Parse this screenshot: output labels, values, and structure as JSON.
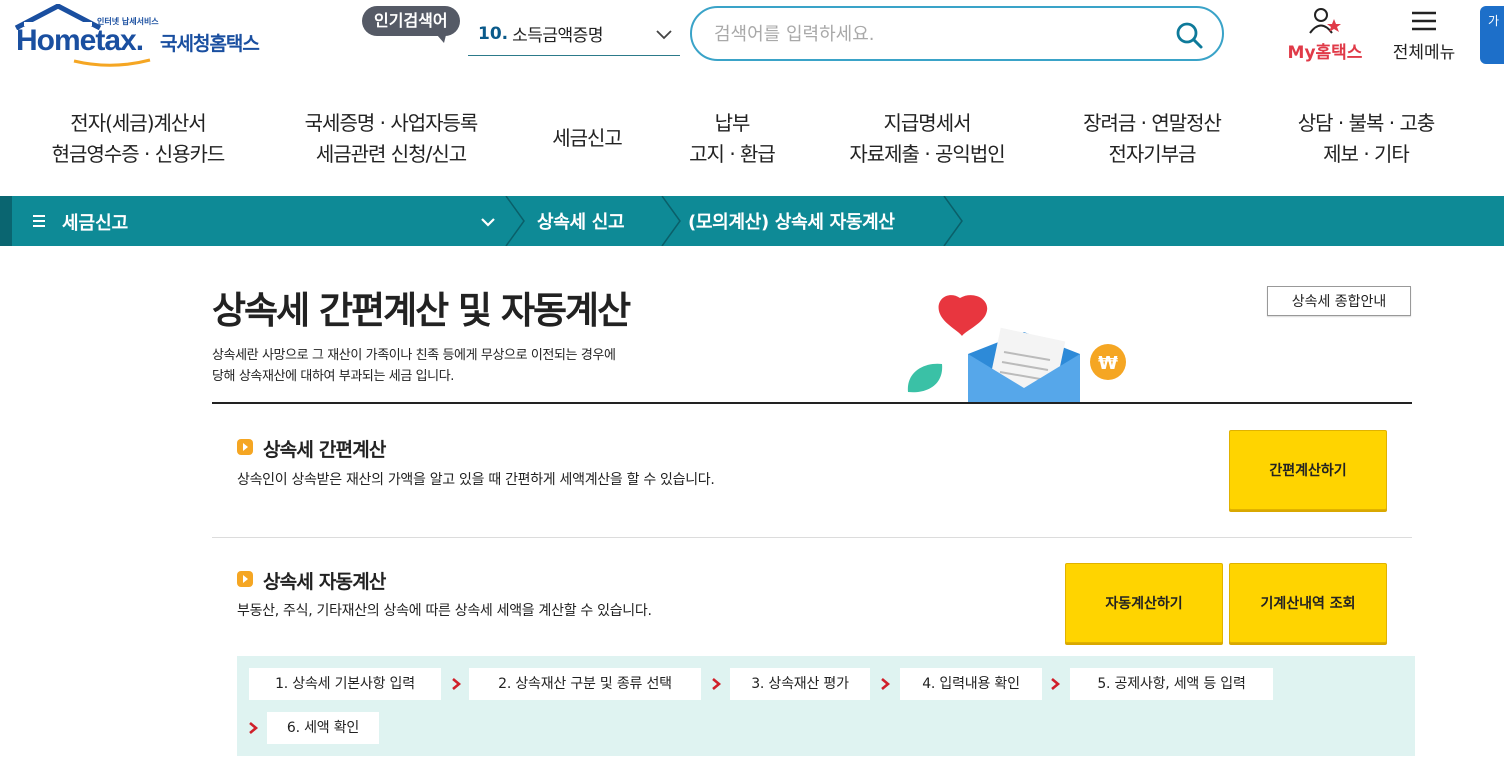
{
  "header": {
    "logo_sub": "인터넷 납세서비스",
    "logo_en": "Hometax.",
    "logo_ko": "국세청홈택스",
    "popular_label": "인기검색어",
    "popular_num": "10.",
    "popular_text": "소득금액증명",
    "search_placeholder": "검색어를 입력하세요.",
    "my_hometax": "My홈택스",
    "all_menu": "전체메뉴",
    "side_tab": "가"
  },
  "gnb": [
    {
      "line1": "전자(세금)계산서",
      "line2": "현금영수증 · 신용카드"
    },
    {
      "line1": "국세증명 · 사업자등록",
      "line2": "세금관련 신청/신고"
    },
    {
      "line1": "세금신고",
      "line2": ""
    },
    {
      "line1": "납부",
      "line2": "고지 · 환급"
    },
    {
      "line1": "지급명세서",
      "line2": "자료제출 · 공익법인"
    },
    {
      "line1": "장려금 · 연말정산",
      "line2": "전자기부금"
    },
    {
      "line1": "상담 · 불복 · 고충",
      "line2": "제보 · 기타"
    }
  ],
  "breadcrumb": {
    "home": "세금신고",
    "level2": "상속세 신고",
    "level3": "(모의계산) 상속세 자동계산"
  },
  "page": {
    "title": "상속세 간편계산 및 자동계산",
    "desc_line1": "상속세란 사망으로 그 재산이 가족이나 친족 등에게 무상으로 이전되는 경우에",
    "desc_line2": "당해 상속재산에 대하여 부과되는 세금 입니다.",
    "guide_button": "상속세 종합안내"
  },
  "simple": {
    "title": "상속세 간편계산",
    "desc": "상속인이 상속받은 재산의 가액을 알고 있을 때 간편하게 세액계산을 할 수 있습니다.",
    "button": "간편계산하기"
  },
  "auto": {
    "title": "상속세 자동계산",
    "desc": "부동산, 주식, 기타재산의 상속에 따른 상속세 세액을 계산할 수 있습니다.",
    "button_calc": "자동계산하기",
    "button_history": "기계산내역 조회",
    "steps": [
      "1. 상속세 기본사항 입력",
      "2. 상속재산 구분 및 종류 선택",
      "3. 상속재산 평가",
      "4. 입력내용 확인",
      "5. 공제사항, 세액 등 입력",
      "6. 세액 확인"
    ]
  },
  "colors": {
    "brand_blue": "#1a4fa0",
    "teal_bar": "#0e8a96",
    "accent_red": "#e03a48",
    "button_yellow": "#ffd400",
    "steps_bg": "#dff3f1"
  }
}
